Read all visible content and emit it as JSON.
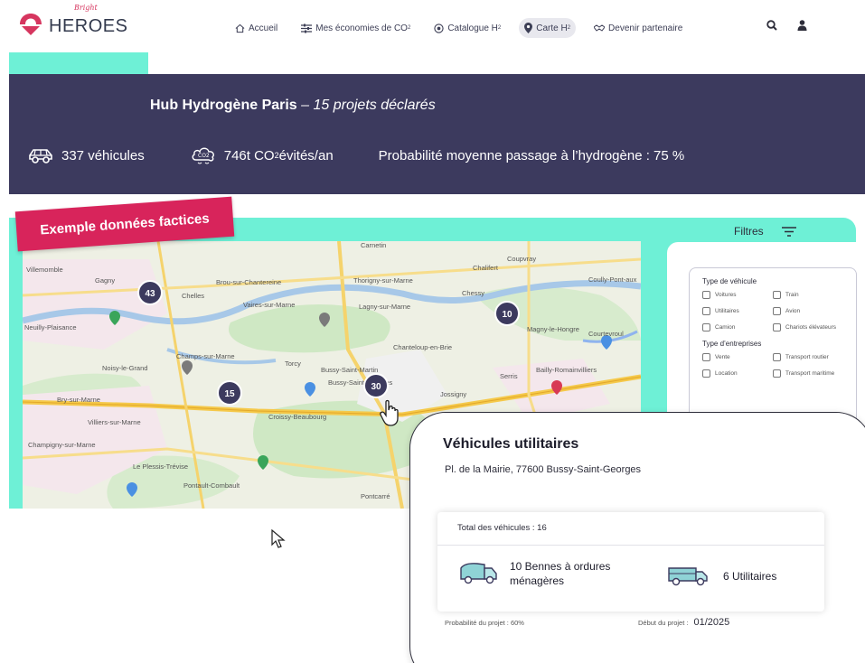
{
  "logo": {
    "script": "Bright",
    "word": "HEROES"
  },
  "nav": {
    "items": [
      {
        "label": "Accueil",
        "sub": ""
      },
      {
        "label": "Mes économies de CO",
        "sub": "2"
      },
      {
        "label": "Catalogue H",
        "sub": "2"
      },
      {
        "label": "Carte H",
        "sub": "2"
      },
      {
        "label": "Devenir partenaire",
        "sub": ""
      }
    ]
  },
  "hero": {
    "title": "Hub Hydrogène Paris",
    "title_sep": " – ",
    "subtitle": "15 projets déclarés",
    "vehicles": "337 véhicules",
    "co2_prefix": "746t CO",
    "co2_sub": "2",
    "co2_suffix": " évités/an",
    "probability": "Probabilité moyenne passage à l’hydrogène : 75 %"
  },
  "stamp": "Exemple données factices",
  "filters": {
    "label": "Filtres",
    "vehicle_type_title": "Type de véhicule",
    "vehicle_types": [
      "Voitures",
      "Train",
      "Utilitaires",
      "Avion",
      "Camion",
      "Chariots élévateurs"
    ],
    "company_type_title": "Type d’entreprises",
    "company_types": [
      "Vente",
      "Transport routier",
      "Location",
      "Transport maritime"
    ]
  },
  "map": {
    "clusters": [
      {
        "count": "43"
      },
      {
        "count": "10"
      },
      {
        "count": "15"
      },
      {
        "count": "30"
      }
    ],
    "places": [
      "Villemomble",
      "Gagny",
      "Brou-sur-Chantereine",
      "Thorigny-sur-Marne",
      "Chalifert",
      "Coupvray",
      "Coully-Pont-aux",
      "Chelles",
      "Vaires-sur-Marne",
      "Lagny-sur-Marne",
      "Chessy",
      "Neuilly-Plaisance",
      "Magny-le-Hongre",
      "Noisy-le-Grand",
      "Champs-sur-Marne",
      "Torcy",
      "Bussy-Saint-Martin",
      "Chanteloup-en-Brie",
      "Serris",
      "Bailly-Romainvilliers",
      "Bry-sur-Marne",
      "Bussy-Saint-Georges",
      "Jossigny",
      "Villiers-sur-Marne",
      "Croissy-Beaubourg",
      "Champigny-sur-Marne",
      "Le Plessis-Trévise",
      "Pontault-Combault",
      "Pontcarré",
      "Carnetin",
      "Courtevroul"
    ]
  },
  "popup": {
    "title": "Véhicules utilitaires",
    "address": "Pl. de la Mairie, 77600 Bussy-Saint-Georges",
    "total": "Total des véhicules : 16",
    "item1": "10 Bennes à ordures ménagères",
    "item2": "6 Utilitaires",
    "probability_label": "Probabilité du projet : 60%",
    "start_label": "Début du projet :",
    "start_value": "01/2025"
  },
  "colors": {
    "navy": "#3c3a5e",
    "mint": "#6ef0d6",
    "accent": "#d8245b",
    "cluster": "#3c3a5e"
  }
}
